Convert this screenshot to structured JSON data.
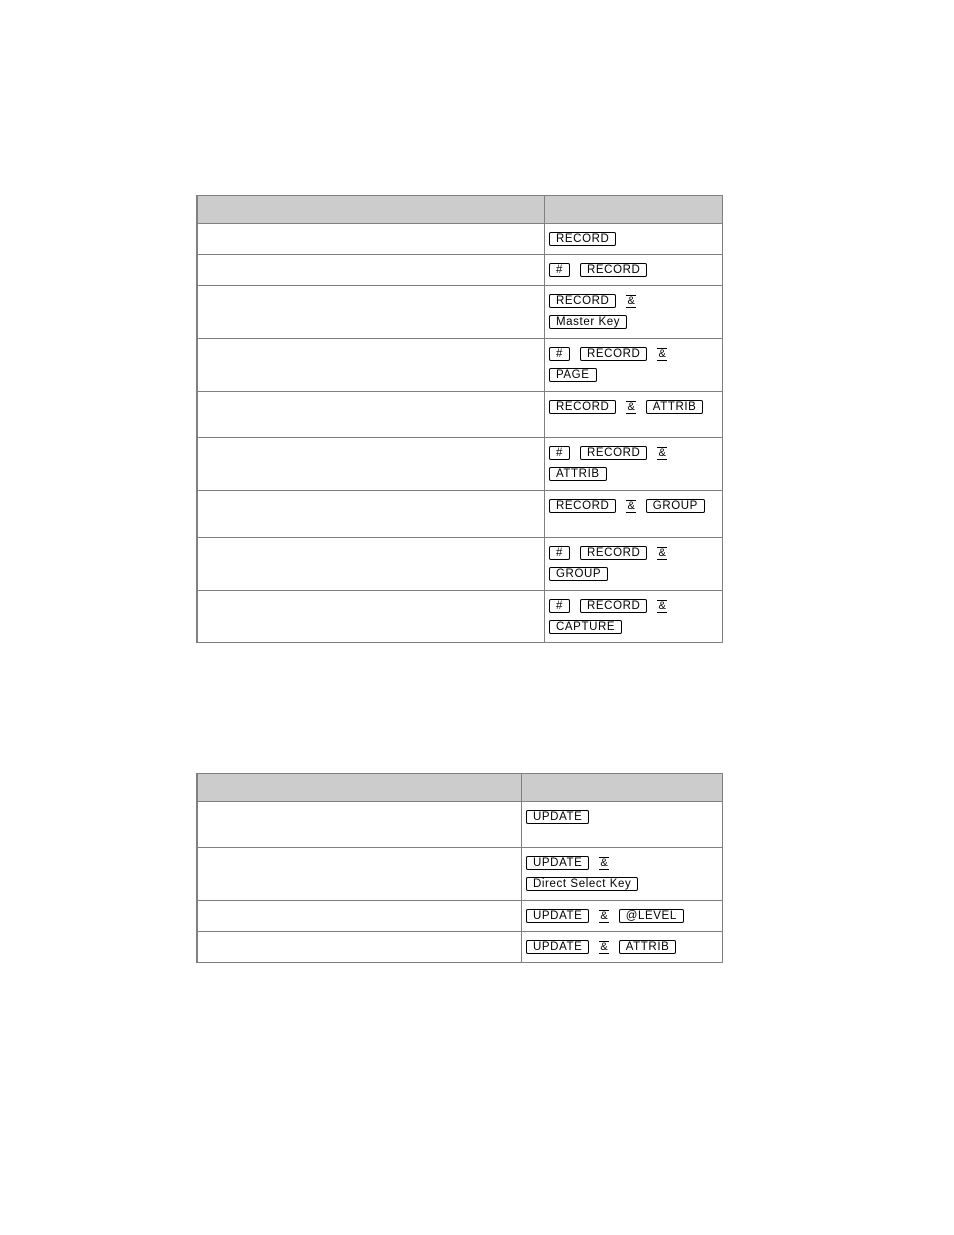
{
  "tables": [
    {
      "header": [
        "",
        ""
      ],
      "rows": [
        {
          "desc": "",
          "lines": [
            [
              "RECORD"
            ]
          ]
        },
        {
          "desc": "",
          "lines": [
            [
              "#",
              "RECORD"
            ]
          ]
        },
        {
          "desc": "",
          "lines": [
            [
              "RECORD",
              "&"
            ],
            [
              "Master Key"
            ]
          ]
        },
        {
          "desc": "",
          "lines": [
            [
              "#",
              "RECORD",
              "&"
            ],
            [
              "PAGE"
            ]
          ]
        },
        {
          "desc": "",
          "lines": [
            [
              "RECORD",
              "&",
              "ATTRIB"
            ]
          ]
        },
        {
          "desc": "",
          "lines": [
            [
              "#",
              "RECORD",
              "&"
            ],
            [
              "ATTRIB"
            ]
          ]
        },
        {
          "desc": "",
          "lines": [
            [
              "RECORD",
              "&",
              "GROUP"
            ]
          ]
        },
        {
          "desc": "",
          "lines": [
            [
              "#",
              "RECORD",
              "&"
            ],
            [
              "GROUP"
            ]
          ]
        },
        {
          "desc": "",
          "lines": [
            [
              "#",
              "RECORD",
              "&"
            ],
            [
              "CAPTURE"
            ]
          ]
        }
      ]
    },
    {
      "header": [
        "",
        ""
      ],
      "rows": [
        {
          "desc": "",
          "lines": [
            [
              "UPDATE"
            ]
          ]
        },
        {
          "desc": "",
          "lines": [
            [
              "UPDATE",
              "&"
            ],
            [
              "Direct Select  Key"
            ]
          ]
        },
        {
          "desc": "",
          "lines": [
            [
              "UPDATE",
              "&",
              "@LEVEL"
            ]
          ]
        },
        {
          "desc": "",
          "lines": [
            [
              "UPDATE",
              "&",
              "ATTRIB"
            ]
          ]
        }
      ]
    }
  ]
}
